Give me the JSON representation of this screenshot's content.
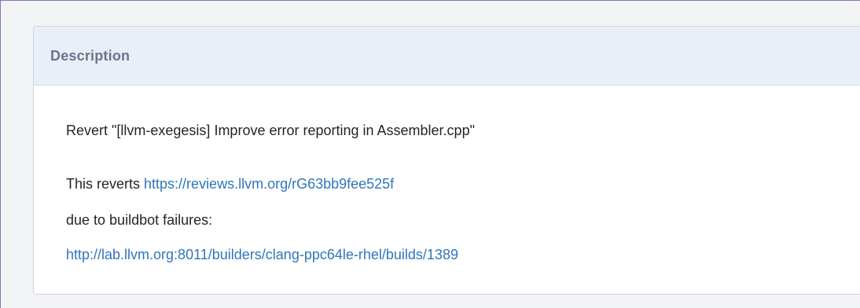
{
  "description": {
    "header": "Description",
    "title_line": "Revert \"[llvm-exegesis] Improve error reporting in Assembler.cpp\"",
    "reverts_prefix": "This reverts ",
    "reverts_link": "https://reviews.llvm.org/rG63bb9fee525f",
    "due_line": "due to buildbot failures:",
    "failure_link": "http://lab.llvm.org:8011/builders/clang-ppc64le-rhel/builds/1389"
  },
  "colors": {
    "link": "#2f76bd",
    "header_bg": "#e9eef7",
    "header_text": "#6b7588"
  }
}
